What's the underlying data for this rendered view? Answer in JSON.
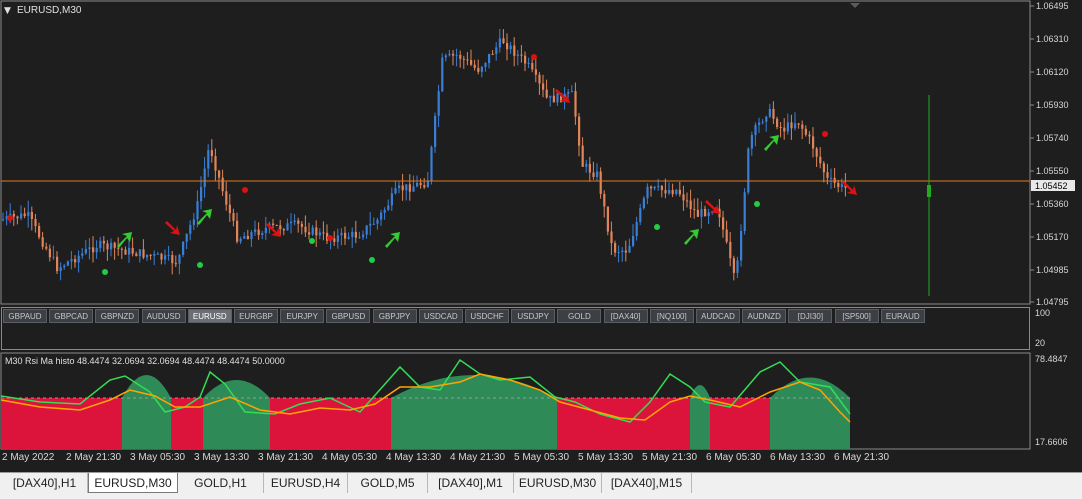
{
  "main_chart": {
    "title": "EURUSD,M30",
    "current_price": "1.05452",
    "price_axis": [
      "1.06495",
      "1.06310",
      "1.06120",
      "1.05930",
      "1.05740",
      "1.05550",
      "1.05360",
      "1.05170",
      "1.04985",
      "1.04795"
    ],
    "colors": {
      "bull": "#3a7fd6",
      "bear": "#e0855a",
      "bid_line": "#e07a22",
      "arrow": "#33cc33",
      "signal_dot_buy": "#22cc44",
      "signal_dot_sell": "#dd1111",
      "vline": "#22aa22"
    }
  },
  "symbol_bar": {
    "symbols": [
      "GBPAUD",
      "GBPCAD",
      "GBPNZD",
      "AUDUSD",
      "EURUSD",
      "EURGBP",
      "EURJPY",
      "GBPUSD",
      "GBPJPY",
      "USDCAD",
      "USDCHF",
      "USDJPY",
      "GOLD",
      "[DAX40]",
      "[NQ100]",
      "AUDCAD",
      "AUDNZD",
      "[DJI30]",
      "[SP500]",
      "EURAUD"
    ],
    "active": "EURUSD",
    "axis": [
      "100",
      "20"
    ]
  },
  "indicator": {
    "title": "M30 Rsi Ma histo 48.4474 32.0694 32.0694 48.4474 48.4474 50.0000",
    "axis_top": "78.4847",
    "axis_bottom": "17.6606",
    "colors": {
      "up": "#2e8b57",
      "down": "#dc143c",
      "rsi": "#33dd55",
      "ma": "#ffa500"
    }
  },
  "time_axis": [
    "2 May 2022",
    "2 May 21:30",
    "3 May 05:30",
    "3 May 13:30",
    "3 May 21:30",
    "4 May 05:30",
    "4 May 13:30",
    "4 May 21:30",
    "5 May 05:30",
    "5 May 13:30",
    "5 May 21:30",
    "6 May 05:30",
    "6 May 13:30",
    "6 May 21:30"
  ],
  "tabs": [
    "[DAX40],H1",
    "EURUSD,M30",
    "GOLD,H1",
    "EURUSD,H4",
    "GOLD,M5",
    "[DAX40],M1",
    "EURUSD,M30",
    "[DAX40],M15"
  ],
  "active_tab": 1
}
